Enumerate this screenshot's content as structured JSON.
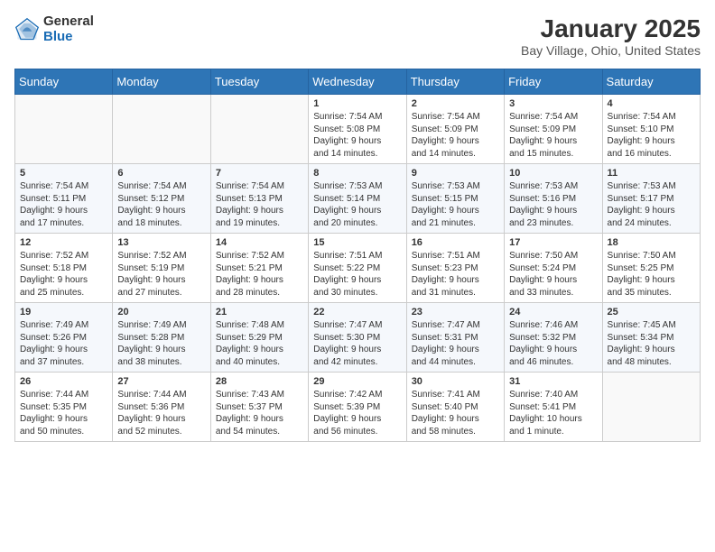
{
  "header": {
    "logo_general": "General",
    "logo_blue": "Blue",
    "title": "January 2025",
    "subtitle": "Bay Village, Ohio, United States"
  },
  "calendar": {
    "days_of_week": [
      "Sunday",
      "Monday",
      "Tuesday",
      "Wednesday",
      "Thursday",
      "Friday",
      "Saturday"
    ],
    "weeks": [
      [
        {
          "day": "",
          "info": ""
        },
        {
          "day": "",
          "info": ""
        },
        {
          "day": "",
          "info": ""
        },
        {
          "day": "1",
          "info": "Sunrise: 7:54 AM\nSunset: 5:08 PM\nDaylight: 9 hours\nand 14 minutes."
        },
        {
          "day": "2",
          "info": "Sunrise: 7:54 AM\nSunset: 5:09 PM\nDaylight: 9 hours\nand 14 minutes."
        },
        {
          "day": "3",
          "info": "Sunrise: 7:54 AM\nSunset: 5:09 PM\nDaylight: 9 hours\nand 15 minutes."
        },
        {
          "day": "4",
          "info": "Sunrise: 7:54 AM\nSunset: 5:10 PM\nDaylight: 9 hours\nand 16 minutes."
        }
      ],
      [
        {
          "day": "5",
          "info": "Sunrise: 7:54 AM\nSunset: 5:11 PM\nDaylight: 9 hours\nand 17 minutes."
        },
        {
          "day": "6",
          "info": "Sunrise: 7:54 AM\nSunset: 5:12 PM\nDaylight: 9 hours\nand 18 minutes."
        },
        {
          "day": "7",
          "info": "Sunrise: 7:54 AM\nSunset: 5:13 PM\nDaylight: 9 hours\nand 19 minutes."
        },
        {
          "day": "8",
          "info": "Sunrise: 7:53 AM\nSunset: 5:14 PM\nDaylight: 9 hours\nand 20 minutes."
        },
        {
          "day": "9",
          "info": "Sunrise: 7:53 AM\nSunset: 5:15 PM\nDaylight: 9 hours\nand 21 minutes."
        },
        {
          "day": "10",
          "info": "Sunrise: 7:53 AM\nSunset: 5:16 PM\nDaylight: 9 hours\nand 23 minutes."
        },
        {
          "day": "11",
          "info": "Sunrise: 7:53 AM\nSunset: 5:17 PM\nDaylight: 9 hours\nand 24 minutes."
        }
      ],
      [
        {
          "day": "12",
          "info": "Sunrise: 7:52 AM\nSunset: 5:18 PM\nDaylight: 9 hours\nand 25 minutes."
        },
        {
          "day": "13",
          "info": "Sunrise: 7:52 AM\nSunset: 5:19 PM\nDaylight: 9 hours\nand 27 minutes."
        },
        {
          "day": "14",
          "info": "Sunrise: 7:52 AM\nSunset: 5:21 PM\nDaylight: 9 hours\nand 28 minutes."
        },
        {
          "day": "15",
          "info": "Sunrise: 7:51 AM\nSunset: 5:22 PM\nDaylight: 9 hours\nand 30 minutes."
        },
        {
          "day": "16",
          "info": "Sunrise: 7:51 AM\nSunset: 5:23 PM\nDaylight: 9 hours\nand 31 minutes."
        },
        {
          "day": "17",
          "info": "Sunrise: 7:50 AM\nSunset: 5:24 PM\nDaylight: 9 hours\nand 33 minutes."
        },
        {
          "day": "18",
          "info": "Sunrise: 7:50 AM\nSunset: 5:25 PM\nDaylight: 9 hours\nand 35 minutes."
        }
      ],
      [
        {
          "day": "19",
          "info": "Sunrise: 7:49 AM\nSunset: 5:26 PM\nDaylight: 9 hours\nand 37 minutes."
        },
        {
          "day": "20",
          "info": "Sunrise: 7:49 AM\nSunset: 5:28 PM\nDaylight: 9 hours\nand 38 minutes."
        },
        {
          "day": "21",
          "info": "Sunrise: 7:48 AM\nSunset: 5:29 PM\nDaylight: 9 hours\nand 40 minutes."
        },
        {
          "day": "22",
          "info": "Sunrise: 7:47 AM\nSunset: 5:30 PM\nDaylight: 9 hours\nand 42 minutes."
        },
        {
          "day": "23",
          "info": "Sunrise: 7:47 AM\nSunset: 5:31 PM\nDaylight: 9 hours\nand 44 minutes."
        },
        {
          "day": "24",
          "info": "Sunrise: 7:46 AM\nSunset: 5:32 PM\nDaylight: 9 hours\nand 46 minutes."
        },
        {
          "day": "25",
          "info": "Sunrise: 7:45 AM\nSunset: 5:34 PM\nDaylight: 9 hours\nand 48 minutes."
        }
      ],
      [
        {
          "day": "26",
          "info": "Sunrise: 7:44 AM\nSunset: 5:35 PM\nDaylight: 9 hours\nand 50 minutes."
        },
        {
          "day": "27",
          "info": "Sunrise: 7:44 AM\nSunset: 5:36 PM\nDaylight: 9 hours\nand 52 minutes."
        },
        {
          "day": "28",
          "info": "Sunrise: 7:43 AM\nSunset: 5:37 PM\nDaylight: 9 hours\nand 54 minutes."
        },
        {
          "day": "29",
          "info": "Sunrise: 7:42 AM\nSunset: 5:39 PM\nDaylight: 9 hours\nand 56 minutes."
        },
        {
          "day": "30",
          "info": "Sunrise: 7:41 AM\nSunset: 5:40 PM\nDaylight: 9 hours\nand 58 minutes."
        },
        {
          "day": "31",
          "info": "Sunrise: 7:40 AM\nSunset: 5:41 PM\nDaylight: 10 hours\nand 1 minute."
        },
        {
          "day": "",
          "info": ""
        }
      ]
    ]
  }
}
